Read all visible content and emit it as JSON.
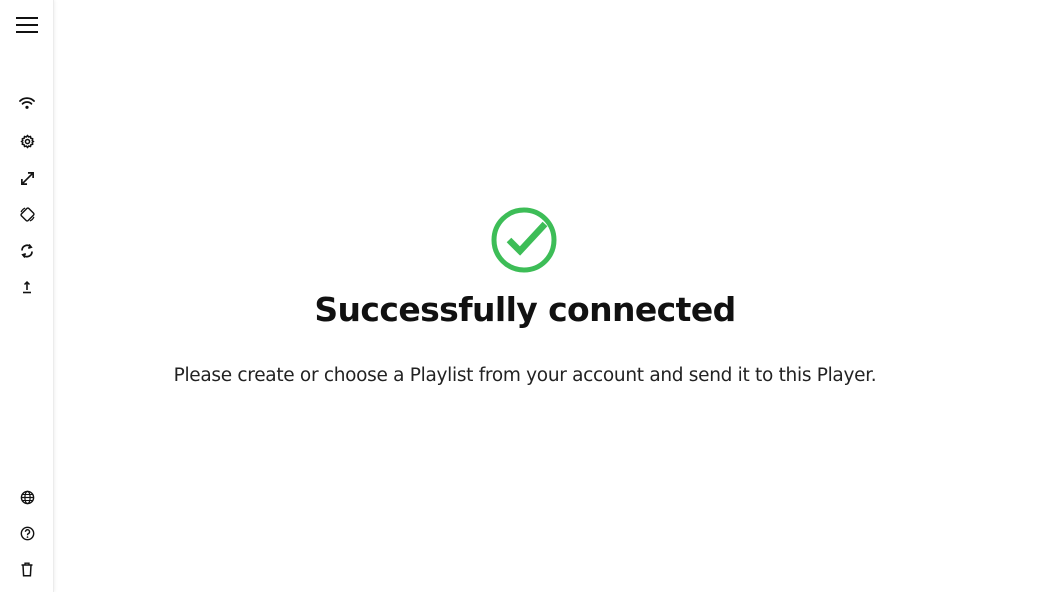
{
  "sidebar": {
    "top_items": [
      {
        "icon": "menu-icon"
      },
      {
        "icon": "wifi-icon"
      },
      {
        "icon": "gear-icon"
      },
      {
        "icon": "expand-icon"
      },
      {
        "icon": "screen-rotation-icon"
      },
      {
        "icon": "refresh-icon"
      },
      {
        "icon": "upload-icon"
      }
    ],
    "bottom_items": [
      {
        "icon": "globe-icon"
      },
      {
        "icon": "help-icon"
      },
      {
        "icon": "trash-icon"
      }
    ]
  },
  "status": {
    "icon": "check-circle-icon",
    "icon_color": "#3dbd57",
    "title": "Successfully connected",
    "message": "Please create or choose a Playlist from your account and send it to this Player."
  }
}
